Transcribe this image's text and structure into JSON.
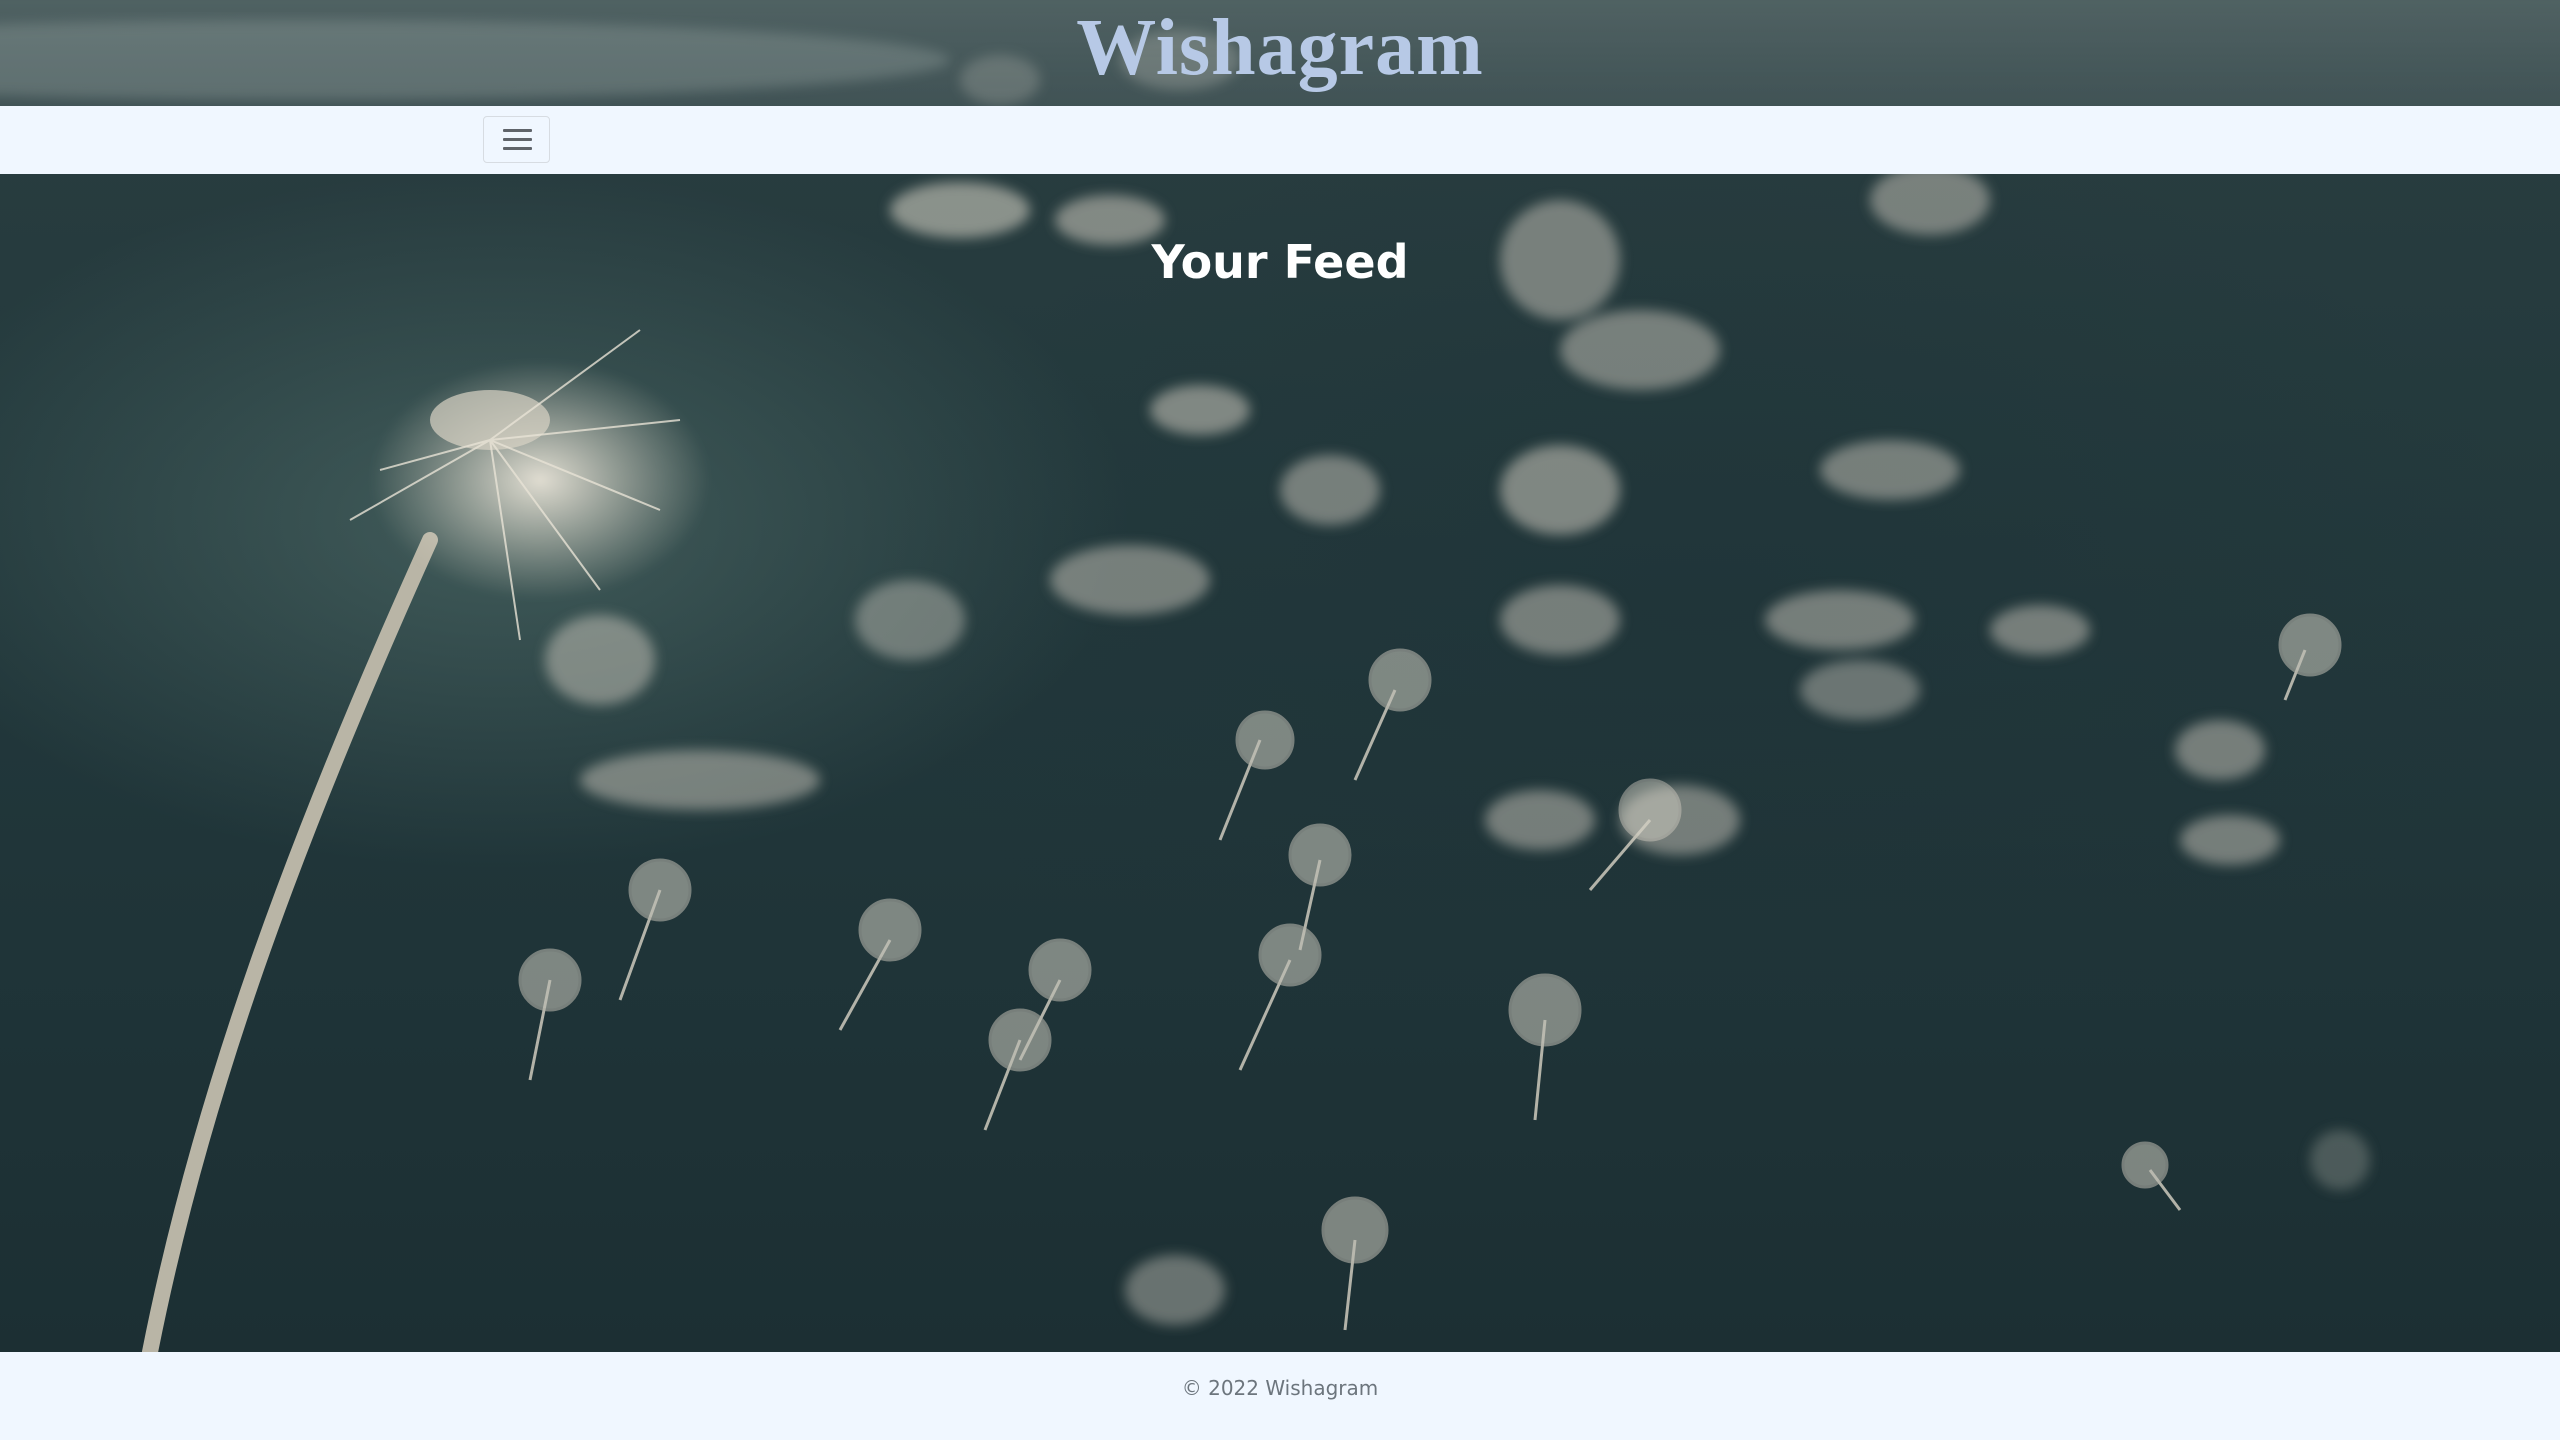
{
  "header": {
    "brand": "Wishagram"
  },
  "navbar": {
    "toggle_icon": "hamburger-menu-icon"
  },
  "main": {
    "title": "Your Feed",
    "background_icon": "dandelion-seeds-photo"
  },
  "footer": {
    "copyright": "© 2022 Wishagram"
  },
  "colors": {
    "brand_text": "#b7c9e6",
    "nav_background": "#f0f7ff",
    "footer_text": "#6c757d",
    "feed_title": "#ffffff"
  }
}
